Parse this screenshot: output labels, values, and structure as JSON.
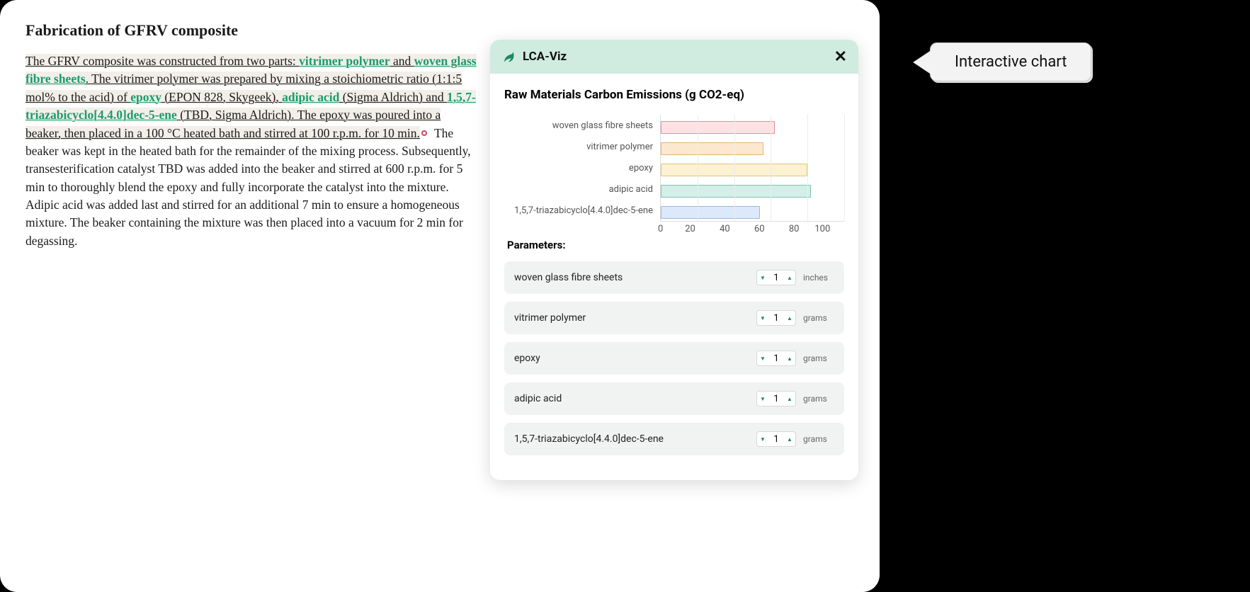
{
  "article": {
    "heading": "Fabrication of GFRV composite",
    "s1": "The GFRV composite was constructed from two parts: ",
    "link_vitrimer": "vitrimer polymer",
    "s2": " and ",
    "link_woven": "woven glass fibre sheets",
    "s3": ". The vitrimer polymer was prepared by mixing a stoichiometric ratio (1:1:5 mol% to the acid) of ",
    "link_epoxy": "epoxy",
    "s4": " (EPON 828, Skygeek), ",
    "link_adipic": "adipic acid",
    "s5": " (Sigma Aldrich) and ",
    "link_tbd": "1,5,7-triazabicyclo[4.4.0]dec-5-ene",
    "s6": " (TBD, Sigma Aldrich). The epoxy was poured into a beaker, then placed in a 100 °C heated bath and stirred at 100 r.p.m. for 10 min.",
    "rest": " The beaker was kept in the heated bath for the remainder of the mixing process. Subsequently, transesterification catalyst TBD was added into the beaker and stirred at 600 r.p.m. for 5 min to thoroughly blend the epoxy and fully incorporate the catalyst into the mixture. Adipic acid was added last and stirred for an additional 7 min to ensure a homogeneous mixture. The beaker containing the mixture was then placed into a vacuum for 2 min for degassing."
  },
  "viz": {
    "app_name": "LCA-Viz",
    "chart_title": "Raw Materials Carbon Emissions (g CO2-eq)",
    "parameters_heading": "Parameters:",
    "parameters": [
      {
        "name": "woven glass fibre sheets",
        "value": "1",
        "unit": "inches"
      },
      {
        "name": "vitrimer polymer",
        "value": "1",
        "unit": "grams"
      },
      {
        "name": "epoxy",
        "value": "1",
        "unit": "grams"
      },
      {
        "name": "adipic acid",
        "value": "1",
        "unit": "grams"
      },
      {
        "name": "1,5,7-triazabicyclo[4.4.0]dec-5-ene",
        "value": "1",
        "unit": "grams"
      }
    ]
  },
  "chart_data": {
    "type": "bar",
    "orientation": "horizontal",
    "title": "Raw Materials Carbon Emissions (g CO2-eq)",
    "xlabel": "",
    "ylabel": "",
    "xlim": [
      0,
      100
    ],
    "ticks": [
      "0",
      "20",
      "40",
      "60",
      "80",
      "100"
    ],
    "categories": [
      "woven glass fibre sheets",
      "vitrimer polymer",
      "epoxy",
      "adipic acid",
      "1,5,7-triazabicyclo[4.4.0]dec-5-ene"
    ],
    "values": [
      62,
      56,
      80,
      82,
      54
    ],
    "colors": [
      "bar-pink",
      "bar-orange",
      "bar-yellow",
      "bar-teal",
      "bar-blue"
    ]
  },
  "callout": {
    "label": "Interactive chart"
  }
}
